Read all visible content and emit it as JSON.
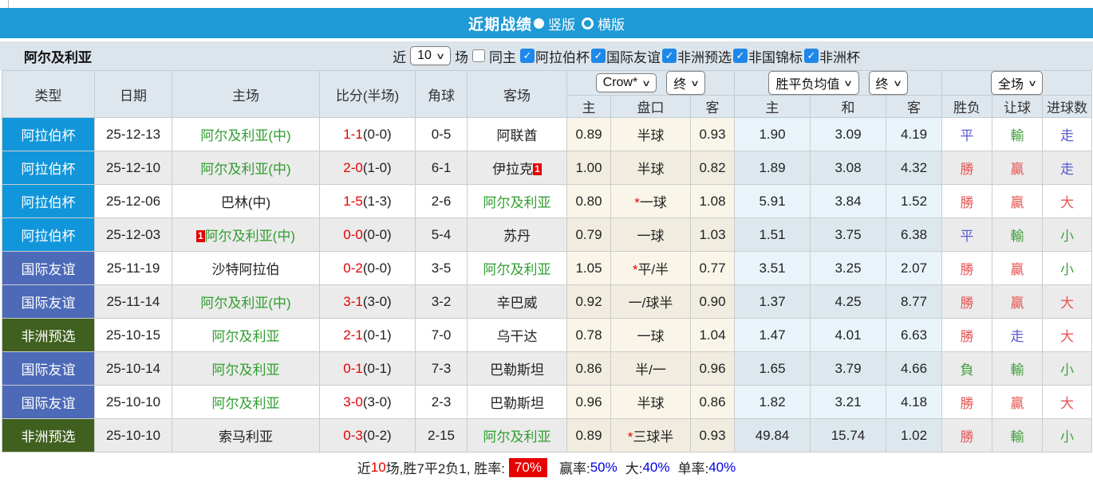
{
  "title_bar": {
    "title": "近期战绩",
    "portrait_label": "竖版",
    "landscape_label": "横版"
  },
  "filter_bar": {
    "team": "阿尔及利亚",
    "near_label": "近",
    "count_value": "10",
    "matches_label": "场",
    "same_home_label": "同主",
    "leagues": [
      {
        "label": "阿拉伯杯",
        "checked": true
      },
      {
        "label": "国际友谊",
        "checked": true
      },
      {
        "label": "非洲预选",
        "checked": true
      },
      {
        "label": "非国锦标",
        "checked": true
      },
      {
        "label": "非洲杯",
        "checked": true
      }
    ]
  },
  "table": {
    "col_headers": {
      "type": "类型",
      "date": "日期",
      "home": "主场",
      "score": "比分(半场)",
      "corner": "角球",
      "away": "客场",
      "odds_home": "主",
      "handicap": "盘口",
      "odds_away": "客",
      "avg_win": "主",
      "avg_draw": "和",
      "avg_lose": "客",
      "wdl": "胜负",
      "let_ball": "让球",
      "goals": "进球数"
    },
    "selects": {
      "company": "Crow*",
      "company_time": "终",
      "avg": "胜平负均值",
      "avg_time": "终",
      "scope": "全场"
    },
    "rows": [
      {
        "type": "阿拉伯杯",
        "cls": "arab",
        "date": "25-12-13",
        "home": "阿尔及利亚(中)",
        "hg": true,
        "hb": "",
        "score": "1-1",
        "half": "(0-0)",
        "corner": "0-5",
        "away": "阿联酋",
        "ag": false,
        "ab": "",
        "o1": "0.89",
        "hc": "半球",
        "star": false,
        "o2": "0.93",
        "a1": "1.90",
        "a2": "3.09",
        "a3": "4.19",
        "res": "平",
        "resc": "blue",
        "hcr": "輸",
        "hcrc": "green",
        "gr": "走",
        "grc": "blue"
      },
      {
        "type": "阿拉伯杯",
        "cls": "arab",
        "date": "25-12-10",
        "home": "阿尔及利亚(中)",
        "hg": true,
        "hb": "",
        "score": "2-0",
        "half": "(1-0)",
        "corner": "6-1",
        "away": "伊拉克",
        "ag": false,
        "ab": "1",
        "o1": "1.00",
        "hc": "半球",
        "star": false,
        "o2": "0.82",
        "a1": "1.89",
        "a2": "3.08",
        "a3": "4.32",
        "res": "勝",
        "resc": "red",
        "hcr": "贏",
        "hcrc": "red",
        "gr": "走",
        "grc": "blue"
      },
      {
        "type": "阿拉伯杯",
        "cls": "arab",
        "date": "25-12-06",
        "home": "巴林(中)",
        "hg": false,
        "hb": "",
        "score": "1-5",
        "half": "(1-3)",
        "corner": "2-6",
        "away": "阿尔及利亚",
        "ag": true,
        "ab": "",
        "o1": "0.80",
        "hc": "一球",
        "star": true,
        "o2": "1.08",
        "a1": "5.91",
        "a2": "3.84",
        "a3": "1.52",
        "res": "勝",
        "resc": "red",
        "hcr": "贏",
        "hcrc": "red",
        "gr": "大",
        "grc": "red"
      },
      {
        "type": "阿拉伯杯",
        "cls": "arab",
        "date": "25-12-03",
        "home": "阿尔及利亚(中)",
        "hg": true,
        "hb": "1",
        "score": "0-0",
        "half": "(0-0)",
        "corner": "5-4",
        "away": "苏丹",
        "ag": false,
        "ab": "",
        "o1": "0.79",
        "hc": "一球",
        "star": false,
        "o2": "1.03",
        "a1": "1.51",
        "a2": "3.75",
        "a3": "6.38",
        "res": "平",
        "resc": "blue",
        "hcr": "輸",
        "hcrc": "green",
        "gr": "小",
        "grc": "green"
      },
      {
        "type": "国际友谊",
        "cls": "friend",
        "date": "25-11-19",
        "home": "沙特阿拉伯",
        "hg": false,
        "hb": "",
        "score": "0-2",
        "half": "(0-0)",
        "corner": "3-5",
        "away": "阿尔及利亚",
        "ag": true,
        "ab": "",
        "o1": "1.05",
        "hc": "平/半",
        "star": true,
        "o2": "0.77",
        "a1": "3.51",
        "a2": "3.25",
        "a3": "2.07",
        "res": "勝",
        "resc": "red",
        "hcr": "贏",
        "hcrc": "red",
        "gr": "小",
        "grc": "green"
      },
      {
        "type": "国际友谊",
        "cls": "friend",
        "date": "25-11-14",
        "home": "阿尔及利亚(中)",
        "hg": true,
        "hb": "",
        "score": "3-1",
        "half": "(3-0)",
        "corner": "3-2",
        "away": "辛巴威",
        "ag": false,
        "ab": "",
        "o1": "0.92",
        "hc": "一/球半",
        "star": false,
        "o2": "0.90",
        "a1": "1.37",
        "a2": "4.25",
        "a3": "8.77",
        "res": "勝",
        "resc": "red",
        "hcr": "贏",
        "hcrc": "red",
        "gr": "大",
        "grc": "red"
      },
      {
        "type": "非洲预选",
        "cls": "afq",
        "date": "25-10-15",
        "home": "阿尔及利亚",
        "hg": true,
        "hb": "",
        "score": "2-1",
        "half": "(0-1)",
        "corner": "7-0",
        "away": "乌干达",
        "ag": false,
        "ab": "",
        "o1": "0.78",
        "hc": "一球",
        "star": false,
        "o2": "1.04",
        "a1": "1.47",
        "a2": "4.01",
        "a3": "6.63",
        "res": "勝",
        "resc": "red",
        "hcr": "走",
        "hcrc": "blue",
        "gr": "大",
        "grc": "red"
      },
      {
        "type": "国际友谊",
        "cls": "friend",
        "date": "25-10-14",
        "home": "阿尔及利亚",
        "hg": true,
        "hb": "",
        "score": "0-1",
        "half": "(0-1)",
        "corner": "7-3",
        "away": "巴勒斯坦",
        "ag": false,
        "ab": "",
        "o1": "0.86",
        "hc": "半/一",
        "star": false,
        "o2": "0.96",
        "a1": "1.65",
        "a2": "3.79",
        "a3": "4.66",
        "res": "負",
        "resc": "green",
        "hcr": "輸",
        "hcrc": "green",
        "gr": "小",
        "grc": "green"
      },
      {
        "type": "国际友谊",
        "cls": "friend",
        "date": "25-10-10",
        "home": "阿尔及利亚",
        "hg": true,
        "hb": "",
        "score": "3-0",
        "half": "(3-0)",
        "corner": "2-3",
        "away": "巴勒斯坦",
        "ag": false,
        "ab": "",
        "o1": "0.96",
        "hc": "半球",
        "star": false,
        "o2": "0.86",
        "a1": "1.82",
        "a2": "3.21",
        "a3": "4.18",
        "res": "勝",
        "resc": "red",
        "hcr": "贏",
        "hcrc": "red",
        "gr": "大",
        "grc": "red"
      },
      {
        "type": "非洲预选",
        "cls": "afq",
        "date": "25-10-10",
        "home": "索马利亚",
        "hg": false,
        "hb": "",
        "score": "0-3",
        "half": "(0-2)",
        "corner": "2-15",
        "away": "阿尔及利亚",
        "ag": true,
        "ab": "",
        "o1": "0.89",
        "hc": "三球半",
        "star": true,
        "o2": "0.93",
        "a1": "49.84",
        "a2": "15.74",
        "a3": "1.02",
        "res": "勝",
        "resc": "red",
        "hcr": "輸",
        "hcrc": "green",
        "gr": "小",
        "grc": "green"
      }
    ]
  },
  "summary": {
    "near": "近",
    "count": "10",
    "seg1": "场,胜7平2负1, 胜率:",
    "win_rate": "70%",
    "win_label": "赢率:",
    "win_pct": "50%",
    "big_label": "大:",
    "big_pct": "40%",
    "single_label": "单率:",
    "single_pct": "40%"
  },
  "colors": {
    "accent_blue": "#1e9ad6",
    "arab_cup": "#1296db",
    "friendly": "#4c6ab8",
    "africa_qualifier": "#3f601e",
    "score_red": "#e60000",
    "team_green": "#2f9e2f",
    "link_blue": "#0000e6"
  }
}
